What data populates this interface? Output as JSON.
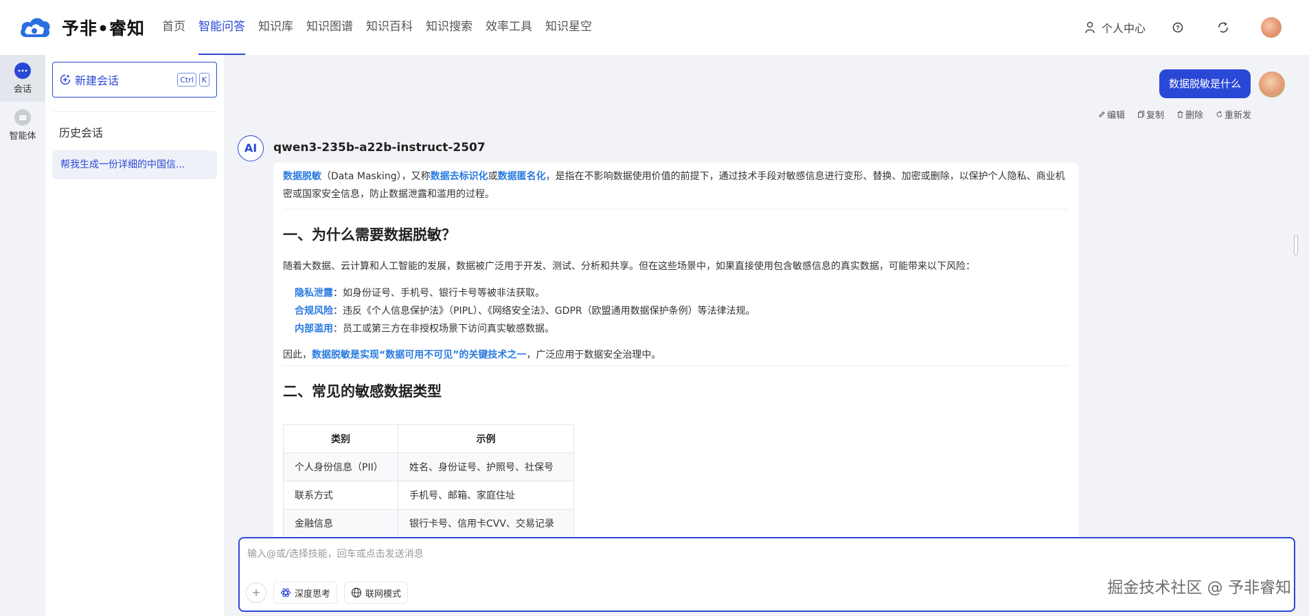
{
  "brand": {
    "name": "予非•睿知"
  },
  "nav": [
    {
      "label": "首页",
      "active": false
    },
    {
      "label": "智能问答",
      "active": true
    },
    {
      "label": "知识库",
      "active": false
    },
    {
      "label": "知识图谱",
      "active": false
    },
    {
      "label": "知识百科",
      "active": false
    },
    {
      "label": "知识搜索",
      "active": false
    },
    {
      "label": "效率工具",
      "active": false
    },
    {
      "label": "知识星空",
      "active": false
    }
  ],
  "header_right": {
    "user_center": "个人中心"
  },
  "rail": {
    "chat": "会话",
    "agent": "智能体"
  },
  "sidebar": {
    "new_chat": "新建会话",
    "shortcut_ctrl": "Ctrl",
    "shortcut_k": "K",
    "history_title": "历史会话",
    "history_item": "帮我生成一份详细的中国信..."
  },
  "chat": {
    "user_message": "数据脱敏是什么",
    "actions": {
      "edit": "编辑",
      "copy": "复制",
      "delete": "删除",
      "resend": "重新发"
    },
    "ai_badge": "AI",
    "model": "qwen3-235b-a22b-instruct-2507",
    "intro": {
      "t1": "数据脱敏",
      "t2": "（Data Masking），又称",
      "t3": "数据去标识化",
      "t4": "或",
      "t5": "数据匿名化",
      "t6": "，是指在不影响数据使用价值的前提下，通过技术手段对敏感信息进行变形、替换、加密或删除，以保护个人隐私、商业机密或国家安全信息，防止数据泄露和滥用的过程。"
    },
    "section1": {
      "title": "一、为什么需要数据脱敏？",
      "para": "随着大数据、云计算和人工智能的发展，数据被广泛用于开发、测试、分析和共享。但在这些场景中，如果直接使用包含敏感信息的真实数据，可能带来以下风险：",
      "risks": [
        {
          "term": "隐私泄露",
          "desc": "：如身份证号、手机号、银行卡号等被非法获取。"
        },
        {
          "term": "合规风险",
          "desc": "：违反《个人信息保护法》（PIPL）、《网络安全法》、GDPR（欧盟通用数据保护条例）等法律法规。"
        },
        {
          "term": "内部滥用",
          "desc": "：员工或第三方在非授权场景下访问真实敏感数据。"
        }
      ],
      "conclusion_pre": "因此，",
      "conclusion_hl": "数据脱敏是实现“数据可用不可见”的关键技术之一",
      "conclusion_post": "，广泛应用于数据安全治理中。"
    },
    "section2": {
      "title": "二、常见的敏感数据类型",
      "headers": [
        "类别",
        "示例"
      ],
      "rows": [
        [
          "个人身份信息（PII）",
          "姓名、身份证号、护照号、社保号"
        ],
        [
          "联系方式",
          "手机号、邮箱、家庭住址"
        ],
        [
          "金融信息",
          "银行卡号、信用卡CVV、交易记录"
        ],
        [
          "",
          ""
        ]
      ]
    }
  },
  "input": {
    "placeholder": "输入@或/选择技能，回车或点击发送消息",
    "deep_think": "深度思考",
    "web_mode": "联网模式",
    "watermark": "掘金技术社区 @ 予非睿知"
  },
  "colors": {
    "accent": "#2a48d6",
    "highlight": "#2a7be0"
  }
}
